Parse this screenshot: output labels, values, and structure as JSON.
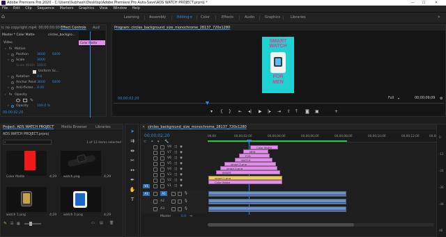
{
  "titlebar": {
    "title": "Adobe Premiere Pro 2020 - C:\\Users\\Subhash\\Desktop\\Adobe Premiere Pro Auto-Save\\ADS WATCH PROJECT.prproj *",
    "min": "—",
    "max": "☐",
    "close": "✕"
  },
  "menu": [
    "File",
    "Edit",
    "Clip",
    "Sequence",
    "Markers",
    "Graphics",
    "View",
    "Window",
    "Help"
  ],
  "workspaces": [
    "Learning",
    "Assembly",
    "Editing",
    "Color",
    "Effects",
    "Audio",
    "Graphics",
    "Libraries"
  ],
  "workspace_active": "Editing",
  "effect_controls": {
    "tabs": [
      "ic no copyright.mp4: 00;00;00;00",
      "Effect Controls",
      "Aud"
    ],
    "source": "Master * Color Matte",
    "clip": "circles_backgro...",
    "timeline_clip": "Color Matte",
    "section_video": "Video",
    "rows": [
      {
        "name": "Motion",
        "v1": "",
        "v2": ""
      },
      {
        "name": "Position",
        "v1": "3600",
        "v2": "6400"
      },
      {
        "name": "Scale",
        "v1": "3000",
        "v2": ""
      },
      {
        "name": "Scale Width",
        "v1": "100.0",
        "v2": ""
      },
      {
        "name": "Uniform Sc...",
        "v1": "",
        "v2": ""
      },
      {
        "name": "Rotation",
        "v1": "0.0",
        "v2": ""
      },
      {
        "name": "Anchor Point",
        "v1": "3600",
        "v2": "6400"
      },
      {
        "name": "Anti-flicker...",
        "v1": "0.00",
        "v2": ""
      },
      {
        "name": "Opacity",
        "v1": "",
        "v2": ""
      },
      {
        "name": "",
        "v1": "",
        "v2": ""
      },
      {
        "name": "Opacity",
        "v1": "100.0 %",
        "v2": ""
      }
    ],
    "timecode": "00;00;02;20"
  },
  "program": {
    "title": "Program: circles_background_size_monochrome_28137_720x1280",
    "timecode_left": "00;00;02;20",
    "fit": "Full",
    "timecode_right": "00;00;09;09",
    "frame_text_top": "SMART\nWATCH",
    "frame_text_bottom": "FOR\nMEN",
    "frame_colors": {
      "bg": "#1fd2d2",
      "text": "#e53a8c"
    }
  },
  "project": {
    "tabs": [
      "Project: ADS WATCH PROJECT",
      "Media Browser",
      "Libraries"
    ],
    "path": "ADS WATCH PROJECT.prproj",
    "count": "1 of 13 items selected",
    "items": [
      {
        "name": "Color Matte",
        "duration": "4;29"
      },
      {
        "name": "watch.png",
        "duration": "4;29"
      },
      {
        "name": "watch 1.png",
        "duration": "4;29"
      },
      {
        "name": "watch 2.png",
        "duration": "4;29"
      }
    ]
  },
  "timeline": {
    "title": "circles_background_size_monochrome_28137_720x1280",
    "timecode": "00;00;02;20",
    "ruler": [
      "00;00",
      "00;00;02;00",
      "00;00;04;00",
      "00;00;06;00",
      "00;00;08;00",
      "00;00;10;00",
      "00;00;12;00",
      "00;00;14;0"
    ],
    "video_tracks": [
      "V8",
      "V7",
      "V6",
      "V5",
      "V4",
      "V3",
      "V2",
      "V1"
    ],
    "audio_tracks": [
      "A1",
      "A2",
      "A3"
    ],
    "source_labels": [
      "V1",
      "A1"
    ],
    "master_label": "Master",
    "master_value": "0.0",
    "clips_video": [
      {
        "label": "Color Matte"
      },
      {
        "label": "MEN"
      },
      {
        "label": "FOR"
      },
      {
        "label": "WATCH"
      },
      {
        "label": "smart 3.png"
      },
      {
        "label": "smart 2.png"
      },
      {
        "label": "SMART"
      },
      {
        "label": "smart 1.png"
      },
      {
        "label": "Color Matte"
      }
    ],
    "clips_audio": [
      "A1 clip",
      "A2 clip",
      "A3 clip"
    ],
    "db_labels": [
      "0",
      "-12",
      "-24",
      "-36",
      "-48",
      "dB"
    ]
  },
  "tools": [
    "selection-tool",
    "track-select-tool",
    "ripple-edit-tool",
    "razor-tool",
    "slip-tool",
    "pen-tool",
    "hand-tool",
    "type-tool"
  ]
}
